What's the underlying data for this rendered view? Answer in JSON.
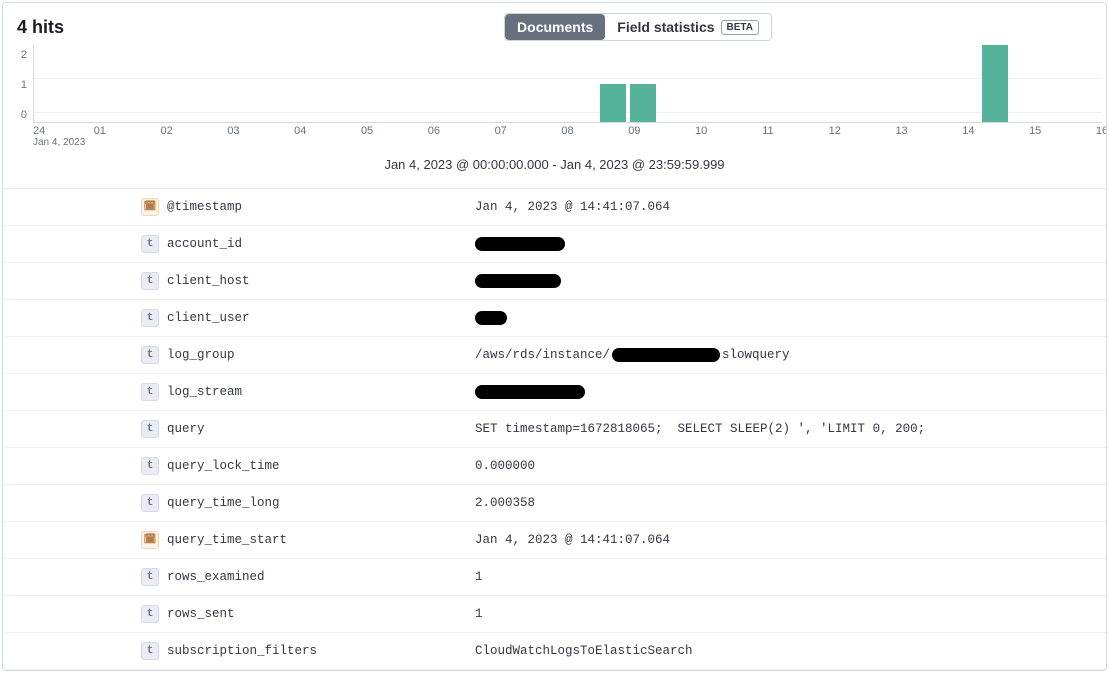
{
  "header": {
    "hits_count": "4",
    "hits_label": "hits",
    "toggle_documents": "Documents",
    "toggle_field_stats": "Field statistics",
    "beta": "BETA"
  },
  "chart_data": {
    "type": "bar",
    "title": "Jan 4, 2023 @ 00:00:00.000 - Jan 4, 2023 @ 23:59:59.999",
    "ylabel": "",
    "xlabel": "",
    "ylim": [
      0,
      2
    ],
    "y_ticks": [
      "2",
      "1",
      "0"
    ],
    "x_ticks": [
      "24",
      "01",
      "02",
      "03",
      "04",
      "05",
      "06",
      "07",
      "08",
      "09",
      "10",
      "11",
      "12",
      "13",
      "14",
      "15",
      "16"
    ],
    "x_sublabel": "Jan 4, 2023",
    "series": [
      {
        "name": "count",
        "values": [
          {
            "x_pct": 53.0,
            "h": 1,
            "w_pct": 2.4
          },
          {
            "x_pct": 55.8,
            "h": 1,
            "w_pct": 2.4
          },
          {
            "x_pct": 88.8,
            "h": 2,
            "w_pct": 2.4
          }
        ]
      }
    ]
  },
  "range_label": "Jan 4, 2023 @ 00:00:00.000 - Jan 4, 2023 @ 23:59:59.999",
  "fields": [
    {
      "icon": "d",
      "name": "@timestamp",
      "value": "Jan 4, 2023 @ 14:41:07.064",
      "redact": null
    },
    {
      "icon": "t",
      "name": "account_id",
      "value": "",
      "redact": [
        90
      ]
    },
    {
      "icon": "t",
      "name": "client_host",
      "value": "",
      "redact": [
        86
      ]
    },
    {
      "icon": "t",
      "name": "client_user",
      "value": "",
      "redact": [
        32
      ]
    },
    {
      "icon": "t",
      "name": "log_group",
      "value_pre": "/aws/rds/instance/",
      "redact": [
        108
      ],
      "value_post": "slowquery"
    },
    {
      "icon": "t",
      "name": "log_stream",
      "value": "",
      "redact": [
        110
      ]
    },
    {
      "icon": "t",
      "name": "query",
      "value": "SET timestamp=1672818065;  SELECT SLEEP(2) ', 'LIMIT 0, 200;",
      "redact": null
    },
    {
      "icon": "t",
      "name": "query_lock_time",
      "value": "0.000000",
      "redact": null
    },
    {
      "icon": "t",
      "name": "query_time_long",
      "value": "2.000358",
      "redact": null
    },
    {
      "icon": "d",
      "name": "query_time_start",
      "value": "Jan 4, 2023 @ 14:41:07.064",
      "redact": null
    },
    {
      "icon": "t",
      "name": "rows_examined",
      "value": "1",
      "redact": null
    },
    {
      "icon": "t",
      "name": "rows_sent",
      "value": "1",
      "redact": null
    },
    {
      "icon": "t",
      "name": "subscription_filters",
      "value": "CloudWatchLogsToElasticSearch",
      "redact": null
    }
  ]
}
